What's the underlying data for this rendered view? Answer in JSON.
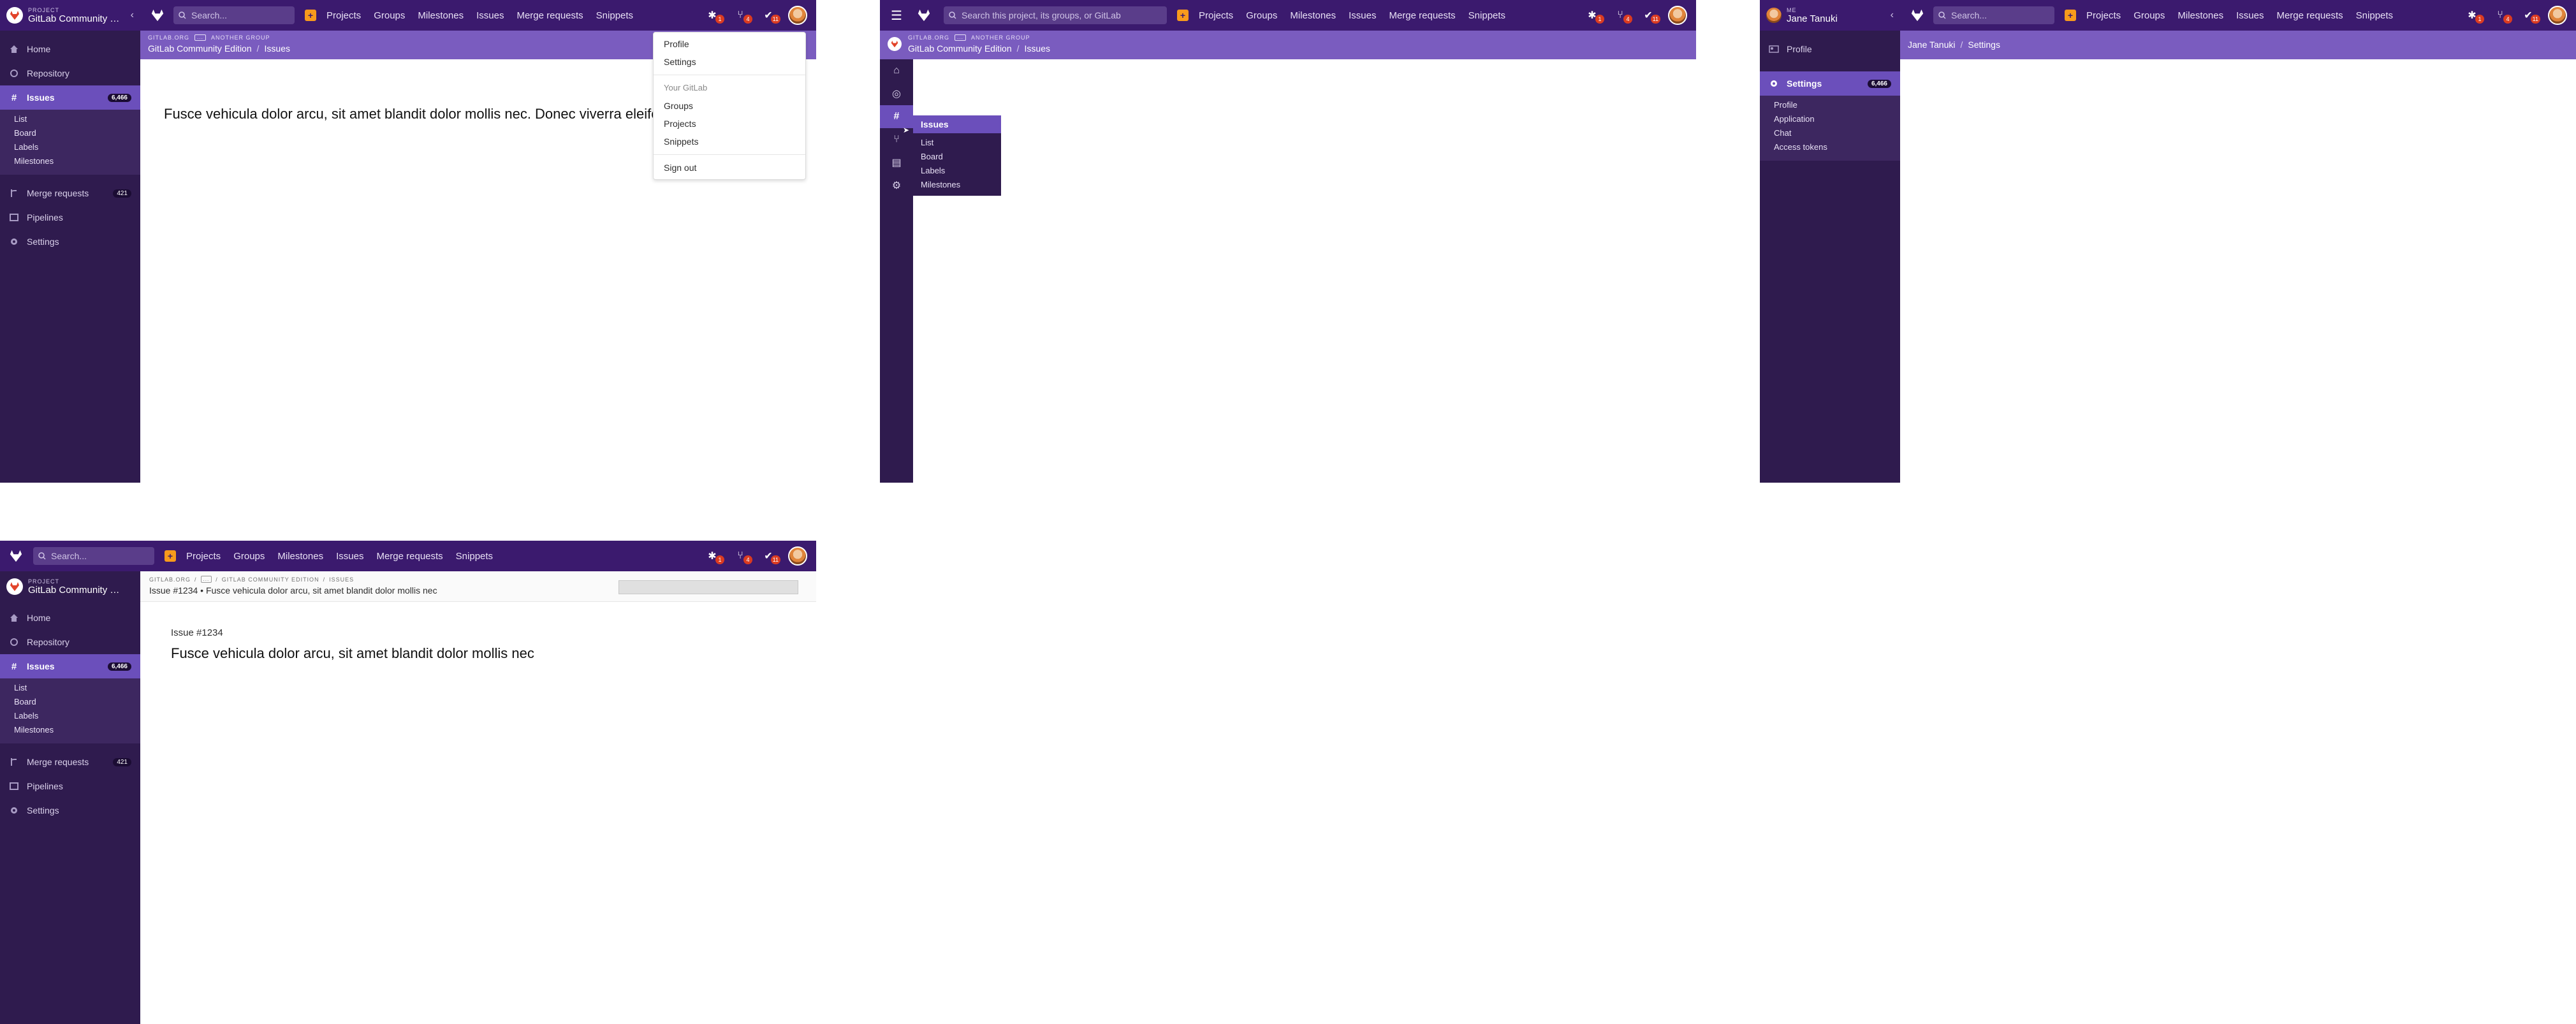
{
  "colors": {
    "topbar": "#3b1a6e",
    "sidebar": "#2f1b4e",
    "accent": "#6b4fbb",
    "breadcrumb_bg": "#7a5cbf",
    "badge": "#db3b21",
    "plus": "#f89a1c"
  },
  "topnav": {
    "search_placeholder": "Search...",
    "search_placeholder_long": "Search this project, its groups, or GitLab",
    "items": [
      "Projects",
      "Groups",
      "Milestones",
      "Issues",
      "Merge requests",
      "Snippets"
    ],
    "badges": {
      "issues": "1",
      "merge_requests": "4",
      "todos": "11"
    }
  },
  "project_sidebar": {
    "context_label": "PROJECT",
    "project_name": "GitLab Community Edition",
    "home": "Home",
    "repository": "Repository",
    "issues": "Issues",
    "issues_count": "6,466",
    "issues_sub": [
      "List",
      "Board",
      "Labels",
      "Milestones"
    ],
    "merge_requests": "Merge requests",
    "merge_requests_count": "421",
    "pipelines": "Pipelines",
    "settings": "Settings"
  },
  "breadcrumbs": {
    "top": [
      "GITLAB.ORG",
      "...",
      "ANOTHER GROUP"
    ],
    "bottom": [
      "GitLab Community Edition",
      "Issues"
    ]
  },
  "panel1": {
    "body_text": "Fusce vehicula dolor arcu, sit amet blandit dolor mollis nec. Donec viverra eleifend lacus, vitae u",
    "dropdown": {
      "profile": "Profile",
      "settings": "Settings",
      "your_gitlab": "Your GitLab",
      "groups": "Groups",
      "projects": "Projects",
      "snippets": "Snippets",
      "sign_out": "Sign out"
    }
  },
  "panel2": {
    "flyout_title": "Issues",
    "flyout_items": [
      "List",
      "Board",
      "Labels",
      "Milestones"
    ]
  },
  "panel3": {
    "me_label": "ME",
    "user_name": "Jane Tanuki",
    "profile": "Profile",
    "settings": "Settings",
    "settings_count": "6,466",
    "settings_sub": [
      "Profile",
      "Application",
      "Chat",
      "Access tokens"
    ],
    "crumb": [
      "Jane Tanuki",
      "Settings"
    ]
  },
  "panel4": {
    "crumbs_top": [
      "GITLAB.ORG",
      "...",
      "GITLAB COMMUNITY EDITION",
      "ISSUES"
    ],
    "crumb_title": "Issue #1234 • Fusce vehicula dolor arcu, sit amet blandit dolor mollis nec",
    "issue_number": "Issue #1234",
    "issue_title": "Fusce vehicula dolor arcu, sit amet blandit dolor mollis nec"
  }
}
